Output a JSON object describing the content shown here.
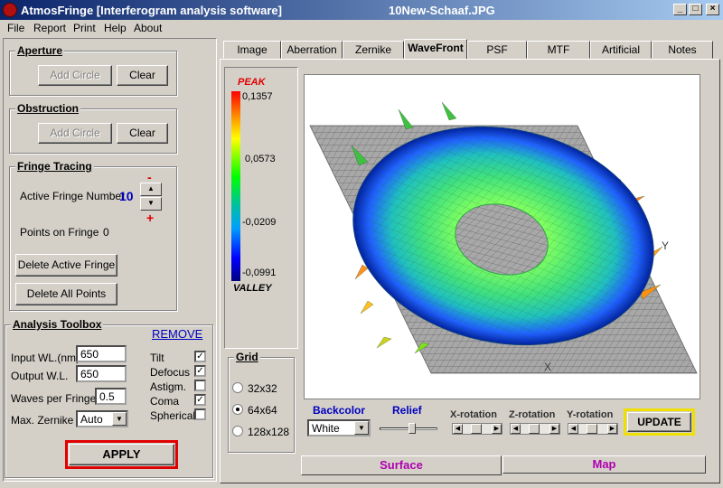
{
  "window": {
    "app_title": "AtmosFringe  [Interferogram analysis software]",
    "file_name": "10New-Schaaf.JPG",
    "min": "_",
    "max": "□",
    "close": "×"
  },
  "menu": [
    "File",
    "Report",
    "Print",
    "Help",
    "About"
  ],
  "aperture": {
    "title": "Aperture",
    "add_circle": "Add Circle",
    "clear": "Clear"
  },
  "obstruction": {
    "title": "Obstruction",
    "add_circle": "Add Circle",
    "clear": "Clear"
  },
  "fringe": {
    "title": "Fringe Tracing",
    "active_label": "Active Fringe Number",
    "active_value": "10",
    "minus": "-",
    "plus": "+",
    "points_label": "Points on  Fringe",
    "points_value": "0",
    "delete_active": "Delete Active Fringe",
    "delete_all": "Delete  All  Points"
  },
  "toolbox": {
    "title": "Analysis Toolbox",
    "remove": "REMOVE",
    "input_wl_label": "Input WL.(nm)",
    "input_wl": "650",
    "output_wl_label": "Output W.L.",
    "output_wl": "650",
    "waves_label": "Waves per Fringe",
    "waves": "0.5",
    "zernike_label": "Max. Zernike",
    "zernike": "Auto",
    "checks": [
      {
        "label": "Tilt",
        "checked": true
      },
      {
        "label": "Defocus",
        "checked": true
      },
      {
        "label": "Astigm.",
        "checked": false
      },
      {
        "label": "Coma",
        "checked": true
      },
      {
        "label": "Spherical",
        "checked": false
      }
    ],
    "apply": "APPLY"
  },
  "tabs": [
    "Image",
    "Aberration",
    "Zernike",
    "WaveFront",
    "PSF",
    "MTF",
    "Artificial",
    "Notes"
  ],
  "active_tab": "WaveFront",
  "scale": {
    "peak_label": "PEAK",
    "valley_label": "VALLEY",
    "ticks": [
      "0,1357",
      "0,0573",
      "-0,0209",
      "-0,0991"
    ]
  },
  "axes": {
    "x": "X",
    "y": "Y"
  },
  "grid": {
    "title": "Grid",
    "options": [
      {
        "label": "32x32",
        "selected": false
      },
      {
        "label": "64x64",
        "selected": true
      },
      {
        "label": "128x128",
        "selected": false
      }
    ]
  },
  "controls": {
    "backcolor_label": "Backcolor",
    "backcolor": "White",
    "relief_label": "Relief",
    "xrot": "X-rotation",
    "zrot": "Z-rotation",
    "yrot": "Y-rotation",
    "update": "UPDATE"
  },
  "bottom_tabs": {
    "surface": "Surface",
    "map": "Map"
  },
  "colors": {
    "accent_red": "#e00000",
    "accent_blue": "#0000c0",
    "purple": "#b000b0",
    "update_border": "#f0e000"
  }
}
